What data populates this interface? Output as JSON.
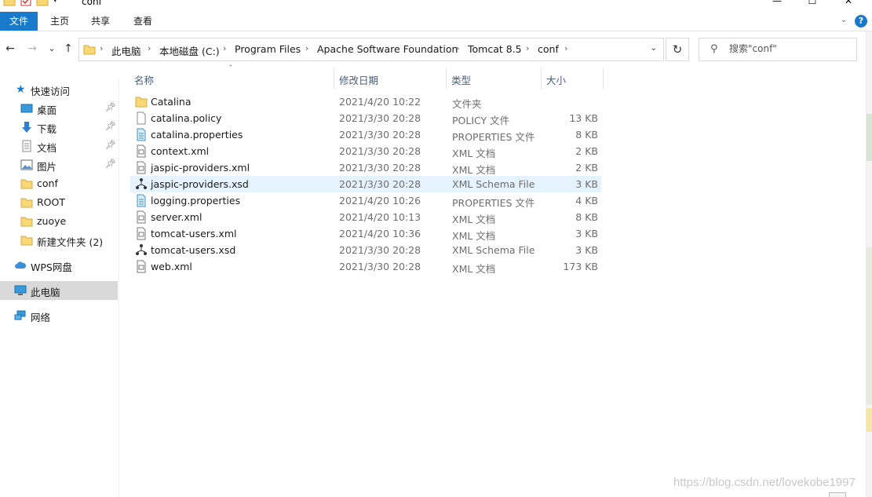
{
  "window": {
    "title": "conf",
    "minimize": "—",
    "maximize": "☐",
    "close": "✕"
  },
  "ribbon": {
    "tabs": [
      "文件",
      "主页",
      "共享",
      "查看"
    ],
    "expand_icon": "chevron-down-icon",
    "help_label": "?"
  },
  "nav": {
    "back": "←",
    "forward": "→",
    "recent": "⌄",
    "up": "↑",
    "breadcrumb": [
      "此电脑",
      "本地磁盘 (C:)",
      "Program Files",
      "Apache Software Foundation",
      "Tomcat 8.5",
      "conf"
    ],
    "refresh": "↻",
    "search_placeholder": "搜索\"conf\""
  },
  "sidebar": {
    "items": [
      {
        "label": "快速访问",
        "icon": "star-icon",
        "pinned": false
      },
      {
        "label": "桌面",
        "icon": "desktop-icon",
        "pinned": true
      },
      {
        "label": "下载",
        "icon": "download-icon",
        "pinned": true
      },
      {
        "label": "文档",
        "icon": "document-icon",
        "pinned": true
      },
      {
        "label": "图片",
        "icon": "picture-icon",
        "pinned": true
      },
      {
        "label": "conf",
        "icon": "folder-icon",
        "pinned": false
      },
      {
        "label": "ROOT",
        "icon": "folder-icon",
        "pinned": false
      },
      {
        "label": "zuoye",
        "icon": "folder-icon",
        "pinned": false
      },
      {
        "label": "新建文件夹 (2)",
        "icon": "folder-icon",
        "pinned": false
      },
      {
        "label": "WPS网盘",
        "icon": "cloud-icon",
        "pinned": false
      },
      {
        "label": "此电脑",
        "icon": "computer-icon",
        "pinned": false,
        "selected": true
      },
      {
        "label": "网络",
        "icon": "network-icon",
        "pinned": false
      }
    ]
  },
  "columns": {
    "name": "名称",
    "date": "修改日期",
    "type": "类型",
    "size": "大小"
  },
  "files": [
    {
      "name": "Catalina",
      "date": "2021/4/20 10:22",
      "type": "文件夹",
      "size": "",
      "icon": "folder-icon"
    },
    {
      "name": "catalina.policy",
      "date": "2021/3/30 20:28",
      "type": "POLICY 文件",
      "size": "13 KB",
      "icon": "file-icon"
    },
    {
      "name": "catalina.properties",
      "date": "2021/3/30 20:28",
      "type": "PROPERTIES 文件",
      "size": "8 KB",
      "icon": "properties-icon"
    },
    {
      "name": "context.xml",
      "date": "2021/3/30 20:28",
      "type": "XML 文档",
      "size": "2 KB",
      "icon": "xml-icon"
    },
    {
      "name": "jaspic-providers.xml",
      "date": "2021/3/30 20:28",
      "type": "XML 文档",
      "size": "2 KB",
      "icon": "xml-icon"
    },
    {
      "name": "jaspic-providers.xsd",
      "date": "2021/3/30 20:28",
      "type": "XML Schema File",
      "size": "3 KB",
      "icon": "schema-icon",
      "selected": true
    },
    {
      "name": "logging.properties",
      "date": "2021/4/20 10:26",
      "type": "PROPERTIES 文件",
      "size": "4 KB",
      "icon": "properties-icon"
    },
    {
      "name": "server.xml",
      "date": "2021/4/20 10:13",
      "type": "XML 文档",
      "size": "8 KB",
      "icon": "xml-icon"
    },
    {
      "name": "tomcat-users.xml",
      "date": "2021/4/20 10:36",
      "type": "XML 文档",
      "size": "3 KB",
      "icon": "xml-icon"
    },
    {
      "name": "tomcat-users.xsd",
      "date": "2021/3/30 20:28",
      "type": "XML Schema File",
      "size": "3 KB",
      "icon": "schema-icon"
    },
    {
      "name": "web.xml",
      "date": "2021/3/30 20:28",
      "type": "XML 文档",
      "size": "173 KB",
      "icon": "xml-icon"
    }
  ],
  "watermark": "https://blog.csdn.net/lovekobe1997",
  "colors": {
    "accent": "#1979ca",
    "selected_row": "#e5f3ff",
    "folder": "#f8d775"
  }
}
